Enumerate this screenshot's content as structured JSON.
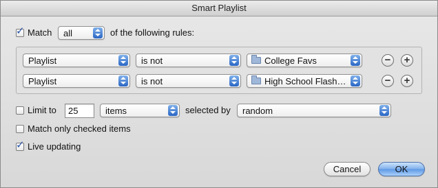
{
  "window": {
    "title": "Smart Playlist"
  },
  "match_row": {
    "checked": true,
    "label": "Match",
    "selector": "all",
    "suffix": "of the following rules:"
  },
  "rules": [
    {
      "field": "Playlist",
      "operator": "is not",
      "value": "College Favs",
      "value_icon": "folder-icon"
    },
    {
      "field": "Playlist",
      "operator": "is not",
      "value": "High School Flash…",
      "value_icon": "folder-icon"
    }
  ],
  "rule_buttons": {
    "remove": "−",
    "add": "+"
  },
  "limit": {
    "checked": false,
    "label": "Limit to",
    "amount": "25",
    "unit": "items",
    "selected_by_label": "selected by",
    "selected_by": "random"
  },
  "match_only_checked": {
    "checked": false,
    "label": "Match only checked items"
  },
  "live_updating": {
    "checked": true,
    "label": "Live updating"
  },
  "buttons": {
    "cancel": "Cancel",
    "ok": "OK"
  },
  "colors": {
    "accent": "#2a66c4",
    "check": "#2b55a8",
    "window_bg": "#dedede"
  }
}
